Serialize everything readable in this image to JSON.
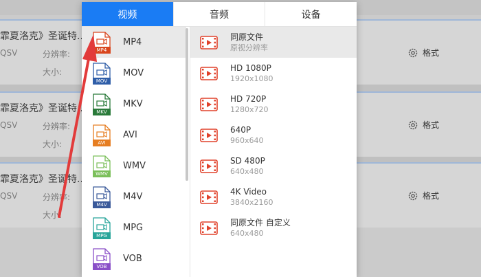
{
  "background": {
    "cards": [
      {
        "name": "霏夏洛克》圣诞特...归",
        "codec": "QSV",
        "res_label": "分辨率:",
        "size_label": "大小:",
        "format_label": "格式"
      },
      {
        "name": "霏夏洛克》圣诞特...归",
        "codec": "QSV",
        "res_label": "分辨率:",
        "size_label": "大小:",
        "format_label": "格式"
      },
      {
        "name": "霏夏洛克》圣诞特...归",
        "codec": "QSV",
        "res_label": "分辨率:",
        "size_label": "大小:",
        "format_label": "格式"
      }
    ]
  },
  "tabs": [
    {
      "label": "视频",
      "active": true
    },
    {
      "label": "音频",
      "active": false
    },
    {
      "label": "设备",
      "active": false
    }
  ],
  "formats": [
    {
      "label": "MP4",
      "tag": "MP4",
      "color": "#d9461e",
      "selected": true
    },
    {
      "label": "MOV",
      "tag": "MOV",
      "color": "#2f5ea8",
      "selected": false
    },
    {
      "label": "MKV",
      "tag": "MKV",
      "color": "#2a7a3a",
      "selected": false
    },
    {
      "label": "AVI",
      "tag": "AVI",
      "color": "#e67e22",
      "selected": false
    },
    {
      "label": "WMV",
      "tag": "WMV",
      "color": "#7bbf5a",
      "selected": false
    },
    {
      "label": "M4V",
      "tag": "M4V",
      "color": "#3b5a9a",
      "selected": false
    },
    {
      "label": "MPG",
      "tag": "MPG",
      "color": "#27a59a",
      "selected": false
    },
    {
      "label": "VOB",
      "tag": "VOB",
      "color": "#8a4fc8",
      "selected": false
    }
  ],
  "resolutions": [
    {
      "name": "同原文件",
      "sub": "原视分辨率",
      "selected": true
    },
    {
      "name": "HD 1080P",
      "sub": "1920x1080",
      "selected": false
    },
    {
      "name": "HD 720P",
      "sub": "1280x720",
      "selected": false
    },
    {
      "name": "640P",
      "sub": "960x640",
      "selected": false
    },
    {
      "name": "SD 480P",
      "sub": "640x480",
      "selected": false
    },
    {
      "name": "4K Video",
      "sub": "3840x2160",
      "selected": false
    },
    {
      "name": "同原文件 自定义",
      "sub": "640x480",
      "selected": false
    }
  ],
  "colors": {
    "accent": "#1a7cf4",
    "video_icon": "#e0412a",
    "annotation_arrow": "#e23b3b"
  }
}
